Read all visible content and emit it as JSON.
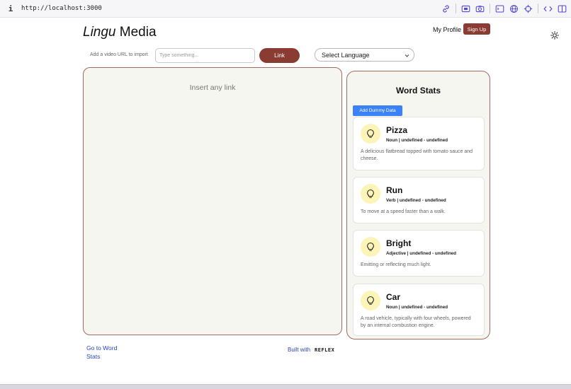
{
  "browser": {
    "info_icon": "info-icon",
    "url": "http://localhost:3000",
    "tools": [
      "link-icon",
      "screen-capture-icon",
      "camera-icon",
      "terminal-icon",
      "globe-icon",
      "crosshair-icon",
      "code-icon",
      "sidebar-icon"
    ]
  },
  "header": {
    "logo_italic": "Lingu",
    "logo_rest": " Media",
    "profile_label": "My Profile",
    "signup_label": "Sign Up",
    "theme_icon": "sun-icon"
  },
  "import": {
    "label": "Add a video URL to import",
    "placeholder": "Type something...",
    "button_label": "Link"
  },
  "language": {
    "selected": "Select Language"
  },
  "link_panel": {
    "hint": "Insert any link"
  },
  "word_stats": {
    "title": "Word Stats",
    "dummy_button": "Add Dummy Data",
    "cards": [
      {
        "word": "Pizza",
        "meta": "Noun | undefined - undefined",
        "definition": "A delicious flatbread topped with tomato sauce and cheese."
      },
      {
        "word": "Run",
        "meta": "Verb | undefined - undefined",
        "definition": "To move at a speed faster than a walk."
      },
      {
        "word": "Bright",
        "meta": "Adjective | undefined - undefined",
        "definition": "Emitting or reflecting much light."
      },
      {
        "word": "Car",
        "meta": "Noun | undefined - undefined",
        "definition": "A road vehicle, typically with four wheels, powered by an internal combustion engine."
      }
    ]
  },
  "footer": {
    "goto_label": "Go to Word Stats",
    "built_with": "Built with",
    "brand": "REFLEX"
  },
  "colors": {
    "accent": "#8a3b32",
    "panel_border": "#a46a62",
    "panel_bg": "#f6f6f1",
    "button_blue": "#3b82f6",
    "bulb_bg": "#fdf4b8",
    "link_text": "#2a44c8"
  }
}
